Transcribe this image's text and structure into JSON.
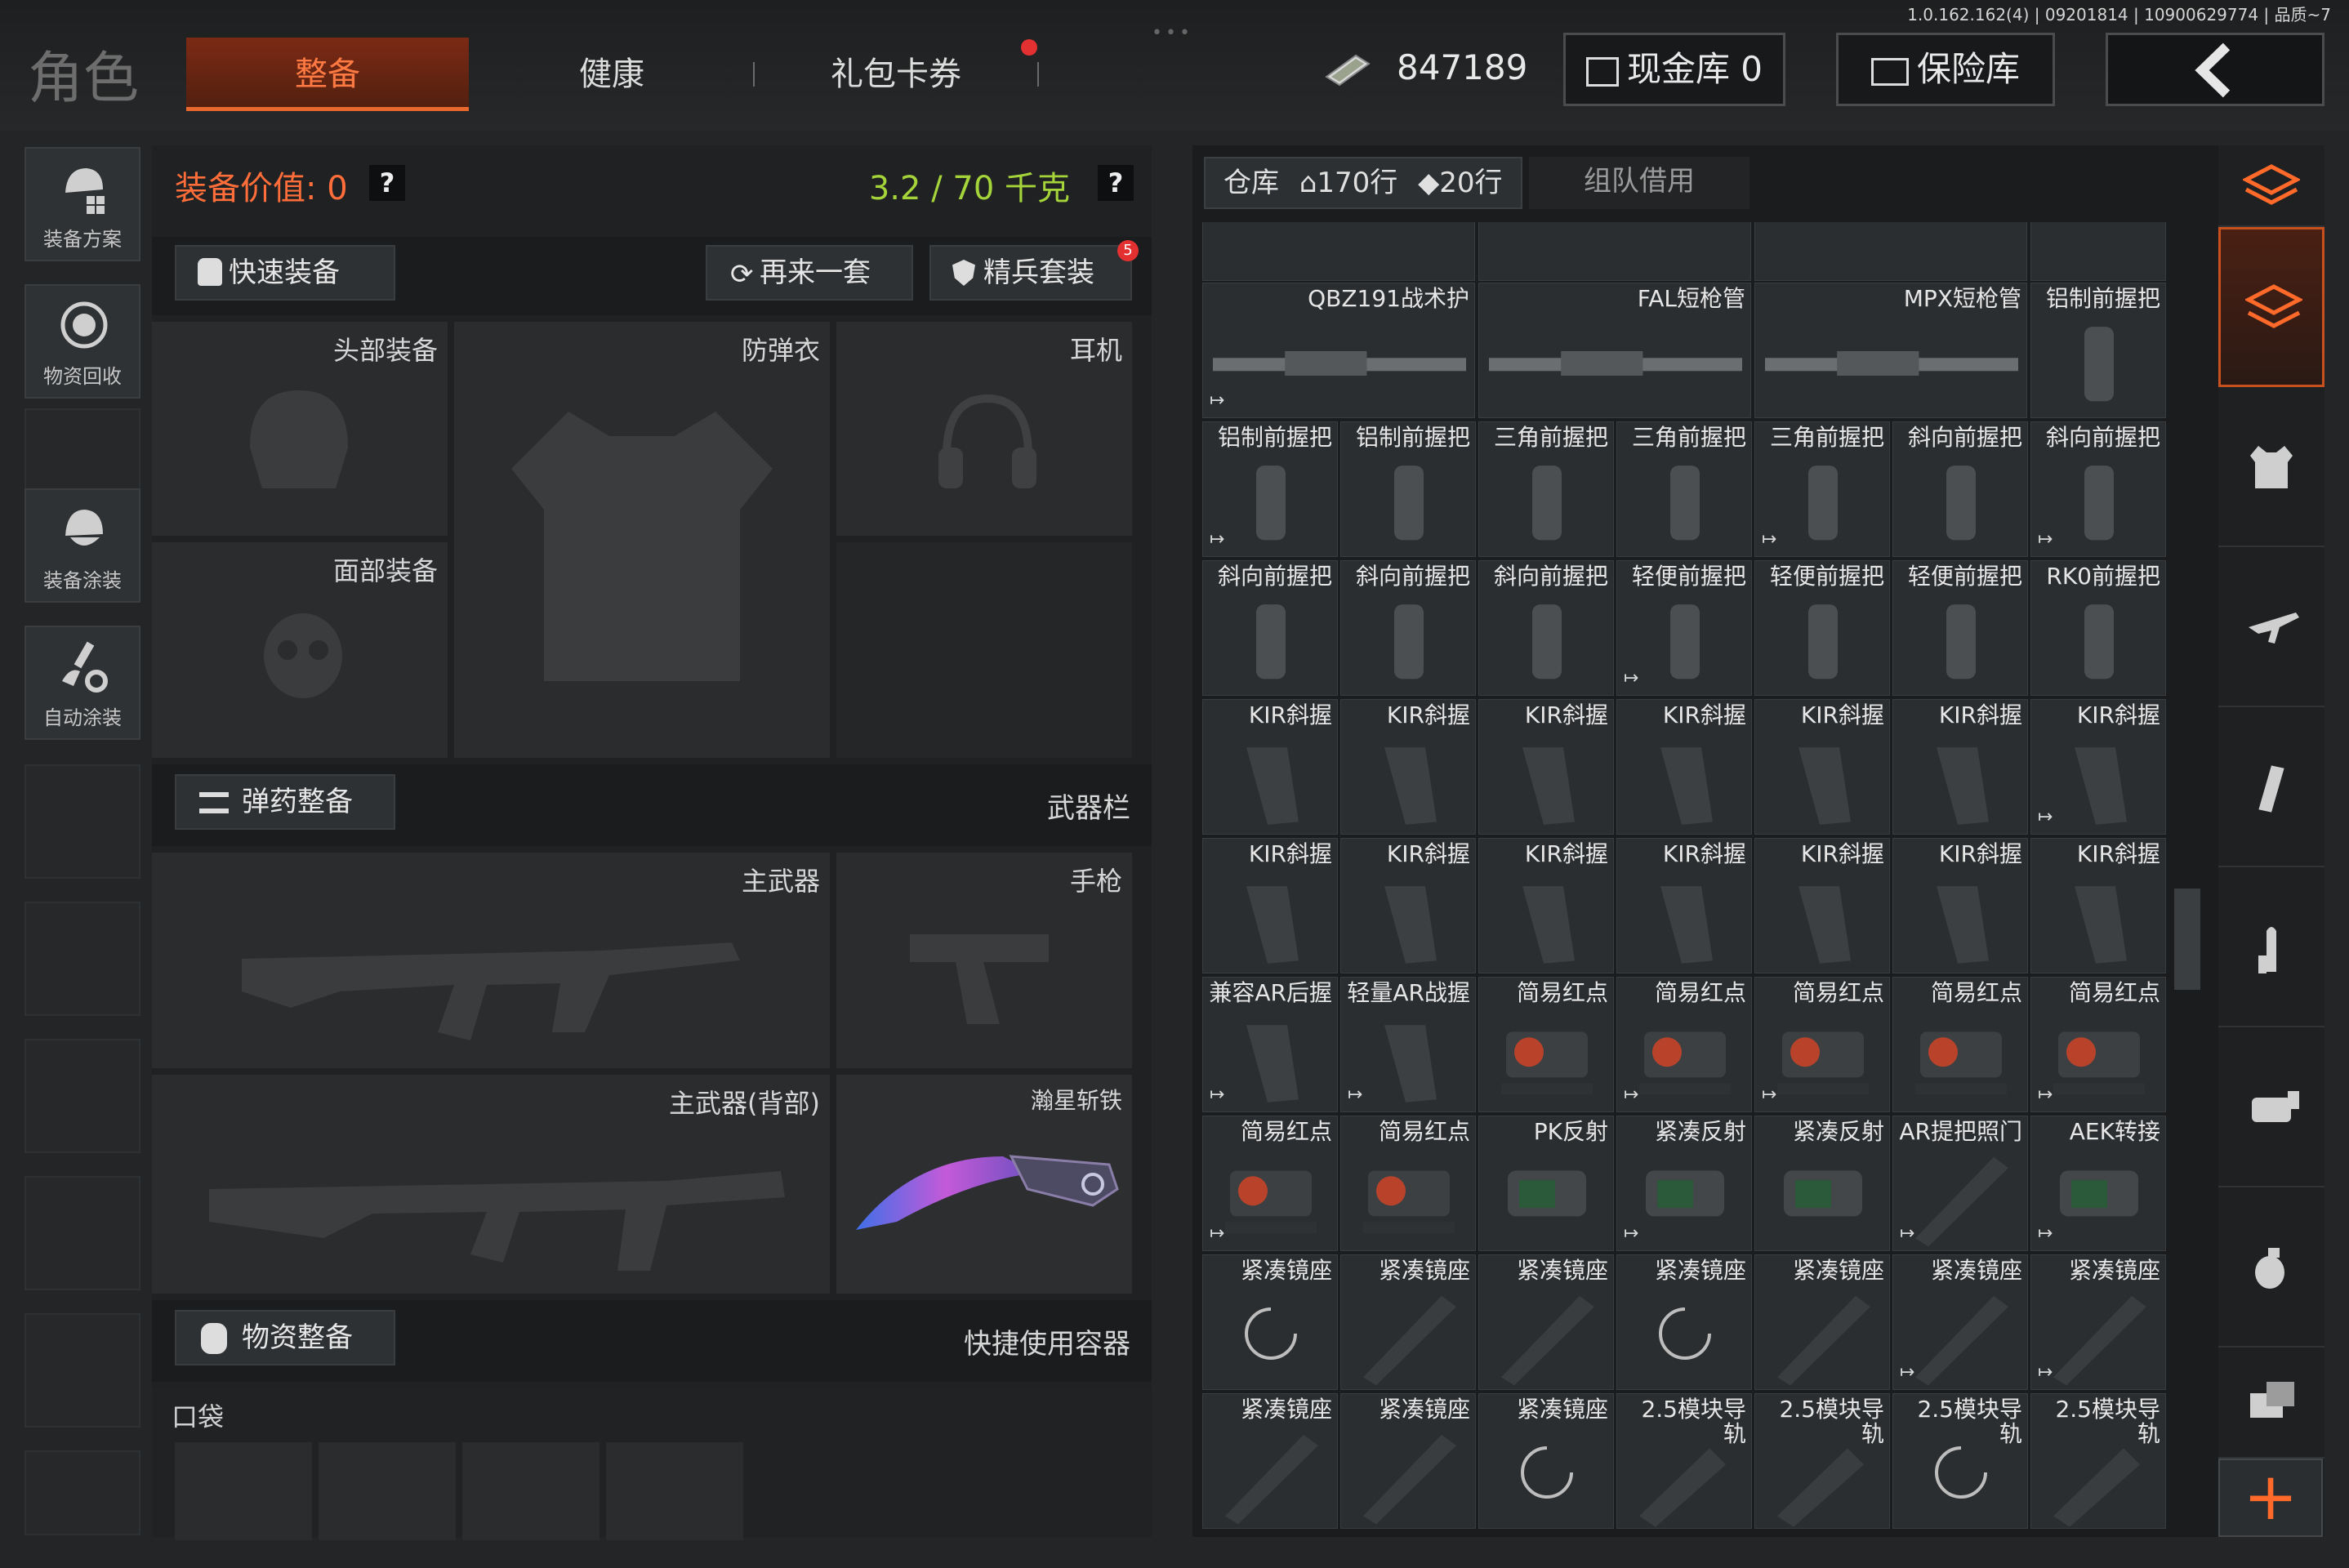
{
  "version": "1.0.162.162(4) | 09201814 | 10900629774 | 品质~7",
  "header": {
    "title": "角色",
    "tabs": [
      "整备",
      "健康",
      "礼包卡券"
    ],
    "money": "847189",
    "cash_vault": "现金库 0",
    "safe": "保险库"
  },
  "sidebar": {
    "items": [
      "装备方案",
      "物资回收",
      "装备涂装",
      "自动涂装"
    ]
  },
  "loadout": {
    "value_label": "装备价值: 0",
    "help": "?",
    "weight": "3.2 / 70 千克",
    "quick_equip": "快速装备",
    "again": "再来一套",
    "elite": "精兵套装",
    "elite_badge": "5",
    "slots": {
      "head": "头部装备",
      "armor": "防弹衣",
      "earphone": "耳机",
      "face": "面部装备",
      "primary": "主武器",
      "pistol": "手枪",
      "primary_back": "主武器(背部)",
      "knife": "瀚星斩铁"
    },
    "ammo_btn": "弹药整备",
    "weapon_bar": "武器栏",
    "supply_btn": "物资整备",
    "quick_container": "快捷使用容器",
    "pocket": "口袋"
  },
  "warehouse": {
    "tab_label": "仓库",
    "rows_a": "170行",
    "rows_b": "20行",
    "team_borrow": "组队借用",
    "rows": [
      [
        "QBZ191战术护",
        "FAL短枪管",
        "MPX短枪管",
        "铝制前握把"
      ],
      [
        "铝制前握把",
        "铝制前握把",
        "三角前握把",
        "三角前握把",
        "三角前握把",
        "斜向前握把",
        "斜向前握把"
      ],
      [
        "斜向前握把",
        "斜向前握把",
        "斜向前握把",
        "轻便前握把",
        "轻便前握把",
        "轻便前握把",
        "RK0前握把"
      ],
      [
        "KIR斜握",
        "KIR斜握",
        "KIR斜握",
        "KIR斜握",
        "KIR斜握",
        "KIR斜握",
        "KIR斜握"
      ],
      [
        "KIR斜握",
        "KIR斜握",
        "KIR斜握",
        "KIR斜握",
        "KIR斜握",
        "KIR斜握",
        "KIR斜握"
      ],
      [
        "兼容AR后握",
        "轻量AR战握",
        "简易红点",
        "简易红点",
        "简易红点",
        "简易红点",
        "简易红点"
      ],
      [
        "简易红点",
        "简易红点",
        "PK反射",
        "紧凑反射",
        "紧凑反射",
        "AR提把照门",
        "AEK转接"
      ],
      [
        "紧凑镜座",
        "紧凑镜座",
        "紧凑镜座",
        "紧凑镜座",
        "紧凑镜座",
        "紧凑镜座",
        "紧凑镜座"
      ],
      [
        "紧凑镜座",
        "紧凑镜座",
        "紧凑镜座",
        "2.5模块导轨",
        "2.5模块导轨",
        "2.5模块导轨",
        "2.5模块导轨"
      ]
    ]
  },
  "icons": {
    "back": "back-arrow-icon",
    "add": "+"
  },
  "colors": {
    "accent": "#e8682d",
    "weight": "#a5d43a",
    "value": "#ff6e3a"
  }
}
